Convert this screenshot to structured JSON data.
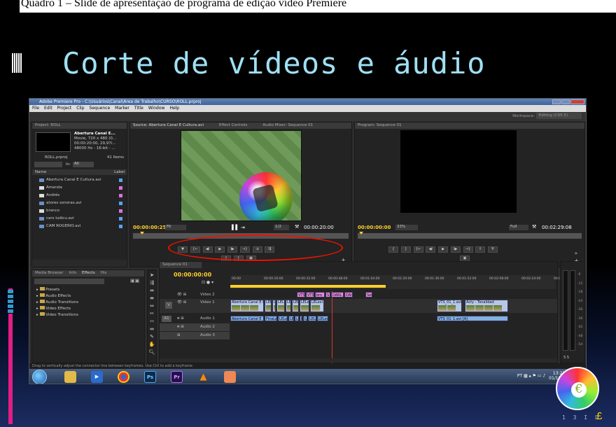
{
  "caption": "Quadro 1 – Slide de apresentação de programa de edição vídeo Premiere",
  "slide_title": "Corte de vídeos e áudio",
  "logo_text": "1 3 I L",
  "logo_symbol": "£",
  "app": {
    "window_title": "Adobe Premiere Pro - C:\\Usuários\\Canal\\Área de Trabalho\\CURSO\\ROLL.prproj",
    "menu": [
      "File",
      "Edit",
      "Project",
      "Clip",
      "Sequence",
      "Marker",
      "Title",
      "Window",
      "Help"
    ],
    "workspace_label": "Workspace:",
    "workspace_value": "Editing (CS5.5)",
    "project": {
      "tab": "Project: ROLL",
      "clip_name": "Abertura Canal E...",
      "clip_line1": "Movie, 720 x 480 (0...",
      "clip_line2": "00:00:20:00, 29,97i...",
      "clip_line3": "48000 Hz - 16-bit - ...",
      "file": "ROLL.prproj",
      "items_count": "41 Items",
      "in_label": "In:",
      "in_value": "All",
      "col_name": "Name",
      "col_label": "Label",
      "items": [
        "Abertura Canal E Cultura.avi",
        "Amanda",
        "Andrés",
        "atores sonoras.avi",
        "branco",
        "cars ludicu.avi",
        "CAM ROGERIO.avi"
      ]
    },
    "source": {
      "tabs": [
        "Source: Abertura Canal E Cultura.avi",
        "Effect Controls",
        "Audio Mixer: Sequence 01"
      ],
      "timecode_in": "00:00:00:25",
      "fit": "Fit",
      "ratio": "1/2",
      "timecode_out": "00:00:20:00"
    },
    "program": {
      "tab": "Program: Sequence 01",
      "timecode_in": "00:00:00:00",
      "zoom": "33%",
      "quality": "Full",
      "timecode_out": "00:02:29:08"
    },
    "effects": {
      "tabs": [
        "Media Browser",
        "Info",
        "Effects",
        "His"
      ],
      "folders": [
        "Presets",
        "Audio Effects",
        "Audio Transitions",
        "Video Effects",
        "Video Transitions"
      ]
    },
    "sequence": {
      "tab": "Sequence 01",
      "timecode": "00:00:00:00",
      "ruler": [
        "00:00",
        "00:00:16:00",
        "00:00:32:00",
        "00:00:48:00",
        "00:01:04:00",
        "00:01:20:00",
        "00:01:36:00",
        "00:01:52:00",
        "00:02:08:00",
        "00:02:24:00",
        "00:02:40:00"
      ],
      "tracks": [
        "Video 2",
        "Video 1",
        "Audio 1",
        "Audio 2",
        "Audio 3"
      ],
      "src_v": "V",
      "src_a": "A1",
      "v2_clips": [
        "VTS",
        "VTS",
        "bro",
        "S",
        "DARL",
        "DAI",
        "Sei"
      ],
      "v1_clips": [
        "Abertura Canal E DARL DA",
        "LEL",
        "L",
        "LEL",
        "LE",
        "LEL",
        "LELexi",
        "LELexi",
        "VTS_01_1.avi [V]",
        "Acty - Tonalidad"
      ],
      "a1_clips": [
        "Abertura Canal E",
        "FinaLex",
        "LELexi",
        "LEL",
        "LEL",
        "L",
        "LE",
        "LELexi",
        "LELexi",
        "VTS_01_1.avi [A]"
      ]
    },
    "audio_meter_scale": [
      "-6",
      "-12",
      "-18",
      "-24",
      "-30",
      "-36",
      "-42",
      "-48",
      "-54"
    ],
    "audio_meter_bottom": "S S",
    "status": "Drag to vertically adjust the connector line between keyframes. Use Ctrl to add a keyframe.",
    "tray": {
      "lang": "PT",
      "time": "13:27",
      "date": "01/10/2..."
    },
    "taskbar_icons": [
      "explorer",
      "media-player",
      "chrome",
      "Ps",
      "Pr",
      "vlc",
      "paint"
    ]
  },
  "colors": {
    "title_text": "#9fe0f4",
    "highlight_oval": "#ee1100",
    "caption_bar": "#ffffff",
    "accent_pink": "#e21d84"
  }
}
